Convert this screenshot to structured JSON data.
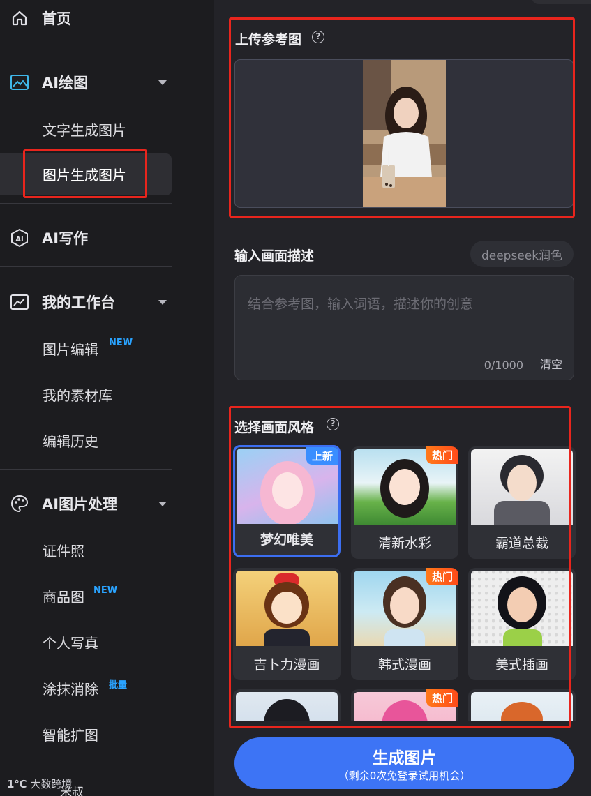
{
  "sidebar": {
    "home": "首页",
    "ai_draw": {
      "label": "AI绘图",
      "items": [
        "文字生成图片",
        "图片生成图片"
      ]
    },
    "ai_write": "AI写作",
    "workbench": {
      "label": "我的工作台",
      "items": [
        {
          "label": "图片编辑",
          "tag": "NEW"
        },
        {
          "label": "我的素材库",
          "tag": ""
        },
        {
          "label": "编辑历史",
          "tag": ""
        }
      ]
    },
    "image_proc": {
      "label": "AI图片处理",
      "items": [
        {
          "label": "证件照",
          "tag": ""
        },
        {
          "label": "商品图",
          "tag": "NEW"
        },
        {
          "label": "个人写真",
          "tag": ""
        },
        {
          "label": "涂抹消除",
          "tag": "批量"
        },
        {
          "label": "智能扩图",
          "tag": ""
        }
      ]
    },
    "bottom_partial": "米叔"
  },
  "upload": {
    "title": "上传参考图",
    "help": "?"
  },
  "prompt": {
    "title": "输入画面描述",
    "deepseek_label": "deepseek润色",
    "placeholder": "结合参考图，输入词语，描述你的创意",
    "count": "0/1000",
    "clear": "清空"
  },
  "style": {
    "title": "选择画面风格",
    "help": "?",
    "cards": [
      {
        "label": "梦幻唯美",
        "badge": "上新"
      },
      {
        "label": "清新水彩",
        "badge": "热门"
      },
      {
        "label": "霸道总裁",
        "badge": ""
      },
      {
        "label": "吉卜力漫画",
        "badge": ""
      },
      {
        "label": "韩式漫画",
        "badge": "热门"
      },
      {
        "label": "美式插画",
        "badge": ""
      },
      {
        "label": "",
        "badge": ""
      },
      {
        "label": "",
        "badge": "热门"
      },
      {
        "label": "",
        "badge": ""
      }
    ]
  },
  "generate": {
    "label": "生成图片",
    "sublabel": "（剩余0次免登录试用机会）"
  },
  "watermark": "大数跨境",
  "colors": {
    "accent": "#3d74f5",
    "highlight": "#e8251d",
    "new_tag": "#2aa3ff",
    "hot_badge": "#ff5a1a"
  }
}
